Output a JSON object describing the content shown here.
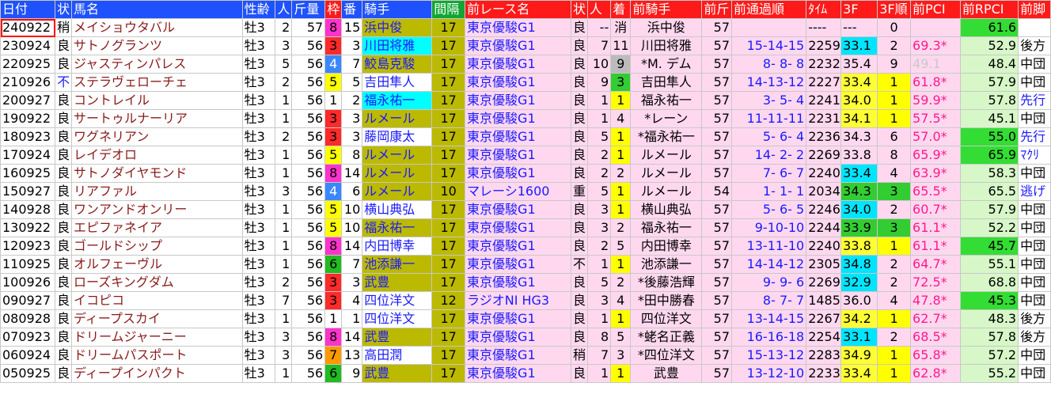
{
  "headers": [
    "日付",
    "状",
    "馬名",
    "性齢",
    "人",
    "斤量",
    "枠",
    "番",
    "騎手",
    "間隔",
    "前レース名",
    "状",
    "人",
    "着",
    "前騎手",
    "前斤",
    "前通過順",
    "ﾀｲﾑ",
    "3F",
    "3F順",
    "前PCI",
    "前RPCI",
    "前脚"
  ],
  "rows": [
    {
      "date": "240922",
      "cond": "稍",
      "horse": "メイショウタバル",
      "sex": "牡3",
      "pop": "2",
      "wt": "57",
      "waku": "8",
      "num": "15",
      "jockey": "浜中俊",
      "interval": "17",
      "prev_race": "東京優駿G1",
      "prev_cond": "良",
      "prev_pop": "--",
      "prev_rank": "消",
      "prev_jockey": "浜中俊",
      "prev_wt": "57",
      "passing": "",
      "time": "----",
      "f3": "---",
      "f3rank": "0",
      "prev_pci": "",
      "prev_rpci": "61.6",
      "style": ""
    },
    {
      "date": "230924",
      "cond": "良",
      "horse": "サトノグランツ",
      "sex": "牡3",
      "pop": "3",
      "wt": "56",
      "waku": "3",
      "num": "3",
      "jockey": "川田将雅",
      "interval": "17",
      "prev_race": "東京優駿G1",
      "prev_cond": "良",
      "prev_pop": "7",
      "prev_rank": "11",
      "prev_jockey": "川田将雅",
      "prev_wt": "57",
      "passing": "15-14-15",
      "time": "2259",
      "f3": "33.1",
      "f3rank": "2",
      "prev_pci": "69.3*",
      "prev_rpci": "52.9",
      "style": "後方"
    },
    {
      "date": "220925",
      "cond": "良",
      "horse": "ジャスティンパレス",
      "sex": "牡3",
      "pop": "5",
      "wt": "56",
      "waku": "4",
      "num": "7",
      "jockey": "鮫島克駿",
      "interval": "17",
      "prev_race": "東京優駿G1",
      "prev_cond": "良",
      "prev_pop": "10",
      "prev_rank": "9",
      "prev_jockey": "*M. デム",
      "prev_wt": "57",
      "passing": "8- 8- 8",
      "time": "2232",
      "f3": "35.4",
      "f3rank": "9",
      "prev_pci": "49.1",
      "prev_rpci": "48.4",
      "style": "中団"
    },
    {
      "date": "210926",
      "cond": "不",
      "horse": "ステラヴェローチェ",
      "sex": "牡3",
      "pop": "2",
      "wt": "56",
      "waku": "5",
      "num": "5",
      "jockey": "吉田隼人",
      "interval": "17",
      "prev_race": "東京優駿G1",
      "prev_cond": "良",
      "prev_pop": "9",
      "prev_rank": "3",
      "prev_jockey": "吉田隼人",
      "prev_wt": "57",
      "passing": "14-13-12",
      "time": "2227",
      "f3": "33.4",
      "f3rank": "1",
      "prev_pci": "61.8*",
      "prev_rpci": "57.9",
      "style": "中団"
    },
    {
      "date": "200927",
      "cond": "良",
      "horse": "コントレイル",
      "sex": "牡3",
      "pop": "1",
      "wt": "56",
      "waku": "1",
      "num": "2",
      "jockey": "福永祐一",
      "interval": "17",
      "prev_race": "東京優駿G1",
      "prev_cond": "良",
      "prev_pop": "1",
      "prev_rank": "1",
      "prev_jockey": "福永祐一",
      "prev_wt": "57",
      "passing": "3- 5- 4",
      "time": "2241",
      "f3": "34.0",
      "f3rank": "1",
      "prev_pci": "59.9*",
      "prev_rpci": "57.8",
      "style": "先行"
    },
    {
      "date": "190922",
      "cond": "良",
      "horse": "サートゥルナーリア",
      "sex": "牡3",
      "pop": "1",
      "wt": "56",
      "waku": "3",
      "num": "3",
      "jockey": "ルメール",
      "interval": "17",
      "prev_race": "東京優駿G1",
      "prev_cond": "良",
      "prev_pop": "1",
      "prev_rank": "4",
      "prev_jockey": "*レーン",
      "prev_wt": "57",
      "passing": "11-11-11",
      "time": "2231",
      "f3": "34.1",
      "f3rank": "1",
      "prev_pci": "57.5*",
      "prev_rpci": "45.1",
      "style": "中団"
    },
    {
      "date": "180923",
      "cond": "良",
      "horse": "ワグネリアン",
      "sex": "牡3",
      "pop": "2",
      "wt": "56",
      "waku": "3",
      "num": "3",
      "jockey": "藤岡康太",
      "interval": "17",
      "prev_race": "東京優駿G1",
      "prev_cond": "良",
      "prev_pop": "5",
      "prev_rank": "1",
      "prev_jockey": "*福永祐一",
      "prev_wt": "57",
      "passing": "5- 6- 4",
      "time": "2236",
      "f3": "34.3",
      "f3rank": "6",
      "prev_pci": "57.0*",
      "prev_rpci": "55.0",
      "style": "先行"
    },
    {
      "date": "170924",
      "cond": "良",
      "horse": "レイデオロ",
      "sex": "牡3",
      "pop": "1",
      "wt": "56",
      "waku": "5",
      "num": "8",
      "jockey": "ルメール",
      "interval": "17",
      "prev_race": "東京優駿G1",
      "prev_cond": "良",
      "prev_pop": "2",
      "prev_rank": "1",
      "prev_jockey": "ルメール",
      "prev_wt": "57",
      "passing": "14- 2- 2",
      "time": "2269",
      "f3": "33.8",
      "f3rank": "8",
      "prev_pci": "65.9*",
      "prev_rpci": "65.9",
      "style": "ﾏｸﾘ"
    },
    {
      "date": "160925",
      "cond": "良",
      "horse": "サトノダイヤモンド",
      "sex": "牡3",
      "pop": "1",
      "wt": "56",
      "waku": "8",
      "num": "14",
      "jockey": "ルメール",
      "interval": "17",
      "prev_race": "東京優駿G1",
      "prev_cond": "良",
      "prev_pop": "2",
      "prev_rank": "2",
      "prev_jockey": "ルメール",
      "prev_wt": "57",
      "passing": "7- 6- 7",
      "time": "2240",
      "f3": "33.4",
      "f3rank": "4",
      "prev_pci": "63.9*",
      "prev_rpci": "58.3",
      "style": "中団"
    },
    {
      "date": "150927",
      "cond": "良",
      "horse": "リアファル",
      "sex": "牡3",
      "pop": "3",
      "wt": "56",
      "waku": "4",
      "num": "6",
      "jockey": "ルメール",
      "interval": "10",
      "prev_race": "マレーシ1600",
      "prev_cond": "重",
      "prev_pop": "5",
      "prev_rank": "1",
      "prev_jockey": "ルメール",
      "prev_wt": "54",
      "passing": "1- 1- 1",
      "time": "2034",
      "f3": "34.3",
      "f3rank": "3",
      "prev_pci": "65.5*",
      "prev_rpci": "65.5",
      "style": "逃げ"
    },
    {
      "date": "140928",
      "cond": "良",
      "horse": "ワンアンドオンリー",
      "sex": "牡3",
      "pop": "1",
      "wt": "56",
      "waku": "5",
      "num": "10",
      "jockey": "横山典弘",
      "interval": "17",
      "prev_race": "東京優駿G1",
      "prev_cond": "良",
      "prev_pop": "3",
      "prev_rank": "1",
      "prev_jockey": "横山典弘",
      "prev_wt": "57",
      "passing": "5- 6- 5",
      "time": "2246",
      "f3": "34.0",
      "f3rank": "2",
      "prev_pci": "60.7*",
      "prev_rpci": "57.9",
      "style": "中団"
    },
    {
      "date": "130922",
      "cond": "良",
      "horse": "エピファネイア",
      "sex": "牡3",
      "pop": "1",
      "wt": "56",
      "waku": "5",
      "num": "10",
      "jockey": "福永祐一",
      "interval": "17",
      "prev_race": "東京優駿G1",
      "prev_cond": "良",
      "prev_pop": "3",
      "prev_rank": "2",
      "prev_jockey": "福永祐一",
      "prev_wt": "57",
      "passing": "9-10-10",
      "time": "2244",
      "f3": "33.9",
      "f3rank": "3",
      "prev_pci": "61.1*",
      "prev_rpci": "52.2",
      "style": "中団"
    },
    {
      "date": "120923",
      "cond": "良",
      "horse": "ゴールドシップ",
      "sex": "牡3",
      "pop": "1",
      "wt": "56",
      "waku": "8",
      "num": "14",
      "jockey": "内田博幸",
      "interval": "17",
      "prev_race": "東京優駿G1",
      "prev_cond": "良",
      "prev_pop": "2",
      "prev_rank": "5",
      "prev_jockey": "内田博幸",
      "prev_wt": "57",
      "passing": "13-11-10",
      "time": "2240",
      "f3": "33.8",
      "f3rank": "1",
      "prev_pci": "61.1*",
      "prev_rpci": "45.7",
      "style": "中団"
    },
    {
      "date": "110925",
      "cond": "良",
      "horse": "オルフェーヴル",
      "sex": "牡3",
      "pop": "1",
      "wt": "56",
      "waku": "6",
      "num": "7",
      "jockey": "池添謙一",
      "interval": "17",
      "prev_race": "東京優駿G1",
      "prev_cond": "不",
      "prev_pop": "1",
      "prev_rank": "1",
      "prev_jockey": "池添謙一",
      "prev_wt": "57",
      "passing": "14-14-12",
      "time": "2305",
      "f3": "34.8",
      "f3rank": "2",
      "prev_pci": "64.7*",
      "prev_rpci": "55.1",
      "style": "中団"
    },
    {
      "date": "100926",
      "cond": "良",
      "horse": "ローズキングダム",
      "sex": "牡3",
      "pop": "2",
      "wt": "56",
      "waku": "3",
      "num": "3",
      "jockey": "武豊",
      "interval": "17",
      "prev_race": "東京優駿G1",
      "prev_cond": "良",
      "prev_pop": "5",
      "prev_rank": "2",
      "prev_jockey": "*後藤浩輝",
      "prev_wt": "57",
      "passing": "9- 9- 6",
      "time": "2269",
      "f3": "32.9",
      "f3rank": "2",
      "prev_pci": "72.5*",
      "prev_rpci": "68.8",
      "style": "中団"
    },
    {
      "date": "090927",
      "cond": "良",
      "horse": "イコピコ",
      "sex": "牡3",
      "pop": "7",
      "wt": "56",
      "waku": "3",
      "num": "4",
      "jockey": "四位洋文",
      "interval": "12",
      "prev_race": "ラジオNI HG3",
      "prev_cond": "良",
      "prev_pop": "3",
      "prev_rank": "4",
      "prev_jockey": "*田中勝春",
      "prev_wt": "57",
      "passing": "8- 7- 7",
      "time": "1485",
      "f3": "36.0",
      "f3rank": "4",
      "prev_pci": "47.8*",
      "prev_rpci": "45.3",
      "style": "中団"
    },
    {
      "date": "080928",
      "cond": "良",
      "horse": "ディープスカイ",
      "sex": "牡3",
      "pop": "1",
      "wt": "56",
      "waku": "1",
      "num": "1",
      "jockey": "四位洋文",
      "interval": "17",
      "prev_race": "東京優駿G1",
      "prev_cond": "良",
      "prev_pop": "1",
      "prev_rank": "1",
      "prev_jockey": "四位洋文",
      "prev_wt": "57",
      "passing": "13-14-15",
      "time": "2267",
      "f3": "34.2",
      "f3rank": "1",
      "prev_pci": "62.7*",
      "prev_rpci": "48.3",
      "style": "後方"
    },
    {
      "date": "070923",
      "cond": "良",
      "horse": "ドリームジャーニー",
      "sex": "牡3",
      "pop": "3",
      "wt": "56",
      "waku": "8",
      "num": "14",
      "jockey": "武豊",
      "interval": "17",
      "prev_race": "東京優駿G1",
      "prev_cond": "良",
      "prev_pop": "8",
      "prev_rank": "5",
      "prev_jockey": "*蛯名正義",
      "prev_wt": "57",
      "passing": "16-16-18",
      "time": "2254",
      "f3": "33.1",
      "f3rank": "2",
      "prev_pci": "68.5*",
      "prev_rpci": "57.8",
      "style": "後方"
    },
    {
      "date": "060924",
      "cond": "良",
      "horse": "ドリームパスポート",
      "sex": "牡3",
      "pop": "3",
      "wt": "56",
      "waku": "7",
      "num": "13",
      "jockey": "高田潤",
      "interval": "17",
      "prev_race": "東京優駿G1",
      "prev_cond": "稍",
      "prev_pop": "7",
      "prev_rank": "3",
      "prev_jockey": "*四位洋文",
      "prev_wt": "57",
      "passing": "15-13-12",
      "time": "2283",
      "f3": "34.9",
      "f3rank": "1",
      "prev_pci": "65.8*",
      "prev_rpci": "57.2",
      "style": "中団"
    },
    {
      "date": "050925",
      "cond": "良",
      "horse": "ディープインパクト",
      "sex": "牡3",
      "pop": "1",
      "wt": "56",
      "waku": "6",
      "num": "9",
      "jockey": "武豊",
      "interval": "17",
      "prev_race": "東京優駿G1",
      "prev_cond": "良",
      "prev_pop": "1",
      "prev_rank": "1",
      "prev_jockey": "武豊",
      "prev_wt": "57",
      "passing": "13-12-10",
      "time": "2233",
      "f3": "33.4",
      "f3rank": "1",
      "prev_pci": "62.8*",
      "prev_rpci": "55.2",
      "style": "中団"
    }
  ],
  "styles": {
    "jockey": [
      "jk-b",
      "jk-c",
      "jk-b",
      "",
      "jk-c",
      "jk-b",
      "",
      "jk-b",
      "jk-b",
      "jk-b",
      "",
      "jk-b",
      "",
      "jk-b",
      "jk-b",
      "",
      "",
      "jk-b",
      "",
      "jk-b"
    ],
    "prev_jockey": [
      "jk-b",
      "jk-c",
      "jk-c",
      "",
      "jk-c",
      "ptk-pink",
      "jk-g",
      "jk-b",
      "jk-b",
      "jk-b",
      "",
      "jk-b",
      "",
      "jk-b",
      "",
      "",
      "",
      "",
      "",
      ""
    ],
    "f3": [
      "",
      "f3-c",
      "",
      "f3-y",
      "f3-y",
      "f3-y",
      "",
      "",
      "f3-c",
      "f3-g",
      "f3-c",
      "f3-g",
      "f3-y",
      "f3-c",
      "f3-c",
      "",
      "f3-y",
      "f3-c",
      "f3-y",
      "f3-y"
    ],
    "f3rank": [
      "",
      "rk-c",
      "",
      "rk-y",
      "rk-y",
      "rk-y",
      "",
      "",
      "rk-c",
      "rk-g",
      "rk-c",
      "rk-g",
      "rk-y",
      "rk-c",
      "rk-c",
      "",
      "rk-y",
      "rk-c",
      "rk-y",
      "rk-y"
    ],
    "prev_rank": [
      "",
      "",
      "rk-x",
      "rk-g",
      "rk-y",
      "",
      "rk-y",
      "rk-y",
      "rk-c",
      "rk-y",
      "rk-y",
      "rk-c",
      "",
      "rk-y",
      "rk-c",
      "",
      "rk-y",
      "",
      "",
      "rk-y"
    ],
    "rpci": [
      "rpci",
      "",
      "",
      "",
      "",
      "",
      "rpci",
      "rpci",
      "",
      "",
      "",
      "",
      "rpci",
      "",
      "",
      "rpci",
      "",
      "",
      "",
      ""
    ]
  }
}
